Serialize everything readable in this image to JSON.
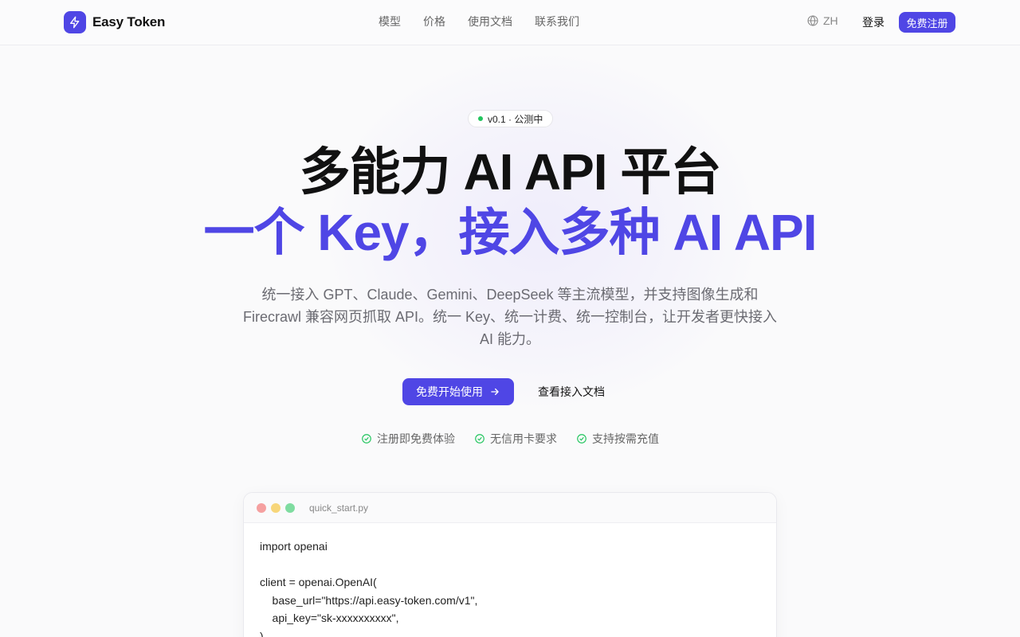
{
  "header": {
    "brand_name": "Easy Token",
    "nav": [
      "模型",
      "价格",
      "使用文档",
      "联系我们"
    ],
    "language": "ZH",
    "login_label": "登录",
    "signup_label": "免费注册"
  },
  "hero": {
    "badge_text": "v0.1 · 公测中",
    "title_line1": "多能力 AI API 平台",
    "title_line2": "一个 Key，接入多种 AI API",
    "subtitle": "统一接入 GPT、Claude、Gemini、DeepSeek 等主流模型，并支持图像生成和 Firecrawl 兼容网页抓取 API。统一 Key、统一计费、统一控制台，让开发者更快接入 AI 能力。",
    "primary_cta": "免费开始使用",
    "secondary_cta": "查看接入文档",
    "features": [
      "注册即免费体验",
      "无信用卡要求",
      "支持按需充值"
    ]
  },
  "code_window": {
    "filename": "quick_start.py",
    "lines": [
      "import openai",
      "",
      "client = openai.OpenAI(",
      "    base_url=\"https://api.easy-token.com/v1\",",
      "    api_key=\"sk-xxxxxxxxxx\",",
      ")"
    ]
  },
  "colors": {
    "accent": "#4f46e5",
    "status_green": "#22c55e"
  }
}
